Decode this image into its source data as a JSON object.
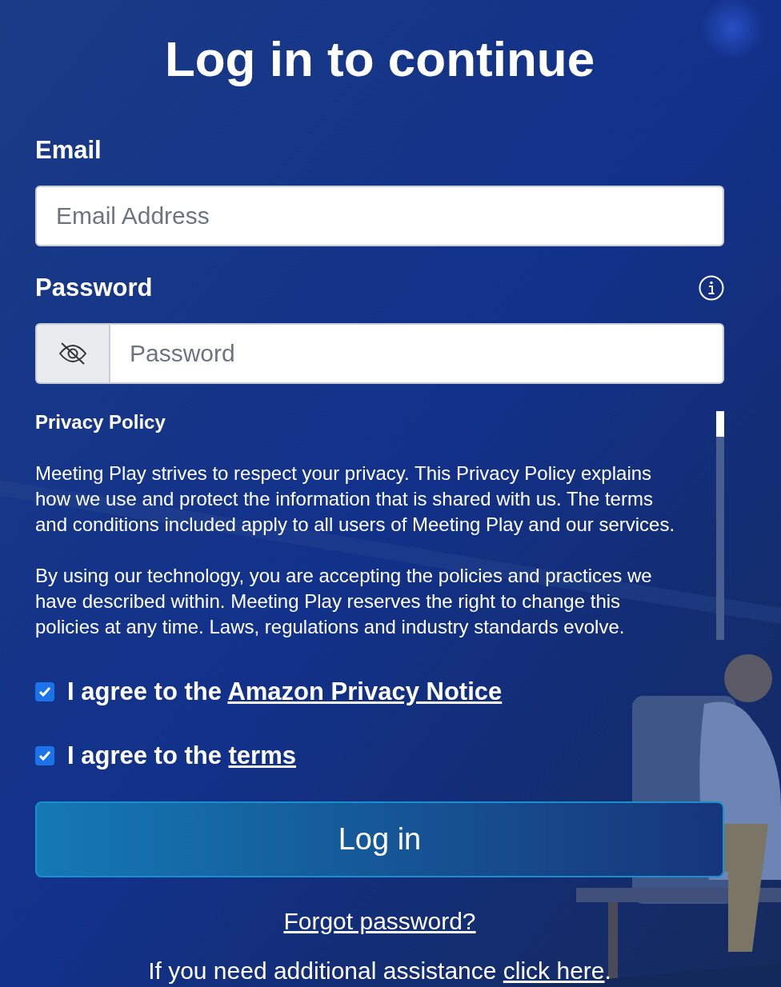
{
  "title": "Log in to continue",
  "email": {
    "label": "Email",
    "placeholder": "Email Address"
  },
  "password": {
    "label": "Password",
    "placeholder": "Password",
    "revealed": false
  },
  "policy": {
    "heading": "Privacy Policy",
    "paragraphs": [
      "Meeting Play strives to respect your privacy. This Privacy Policy explains how we use and protect the information that is shared with us. The terms and conditions included apply to all users of Meeting Play and our services.",
      "By using our technology, you are accepting the policies and practices we have described within. Meeting Play reserves the right to change this policies at any time. Laws, regulations and industry standards evolve."
    ]
  },
  "agreements": [
    {
      "text": "I agree to the ",
      "link": "Amazon Privacy Notice",
      "checked": true
    },
    {
      "text": "I agree to the ",
      "link": "terms",
      "checked": true
    }
  ],
  "login_button": "Log in",
  "forgot_link": "Forgot password?",
  "assistance": {
    "text": "If you need additional assistance ",
    "link": "click here",
    "after": "."
  }
}
